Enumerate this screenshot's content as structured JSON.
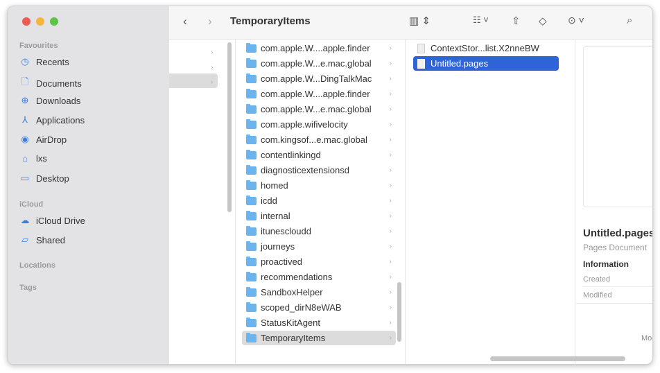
{
  "window": {
    "title": "TemporaryItems"
  },
  "sidebar": {
    "favourites_label": "Favourites",
    "favourites": [
      {
        "label": "Recents",
        "icon": "clock-icon"
      },
      {
        "label": "Documents",
        "icon": "document-icon"
      },
      {
        "label": "Downloads",
        "icon": "download-icon"
      },
      {
        "label": "Applications",
        "icon": "applications-icon"
      },
      {
        "label": "AirDrop",
        "icon": "airdrop-icon"
      },
      {
        "label": "lxs",
        "icon": "home-icon"
      },
      {
        "label": "Desktop",
        "icon": "desktop-icon"
      }
    ],
    "icloud_label": "iCloud",
    "icloud": [
      {
        "label": "iCloud Drive",
        "icon": "cloud-icon"
      },
      {
        "label": "Shared",
        "icon": "shared-folder-icon"
      }
    ],
    "locations_label": "Locations",
    "tags_label": "Tags"
  },
  "folders": [
    "com.apple.W....apple.finder",
    "com.apple.W...e.mac.global",
    "com.apple.W...DingTalkMac",
    "com.apple.W....apple.finder",
    "com.apple.W...e.mac.global",
    "com.apple.wifivelocity",
    "com.kingsof...e.mac.global",
    "contentlinkingd",
    "diagnosticextensionsd",
    "homed",
    "icdd",
    "internal",
    "itunescloudd",
    "journeys",
    "proactived",
    "recommendations",
    "SandboxHelper",
    "scoped_dirN8eWAB",
    "StatusKitAgent",
    "TemporaryItems"
  ],
  "files": [
    "ContextStor...list.X2nneBW",
    "Untitled.pages"
  ],
  "preview": {
    "name": "Untitled.pages",
    "kind": "Pages Document",
    "info_label": "Information",
    "created_label": "Created",
    "modified_label": "Modified",
    "more_label": "Mo"
  }
}
